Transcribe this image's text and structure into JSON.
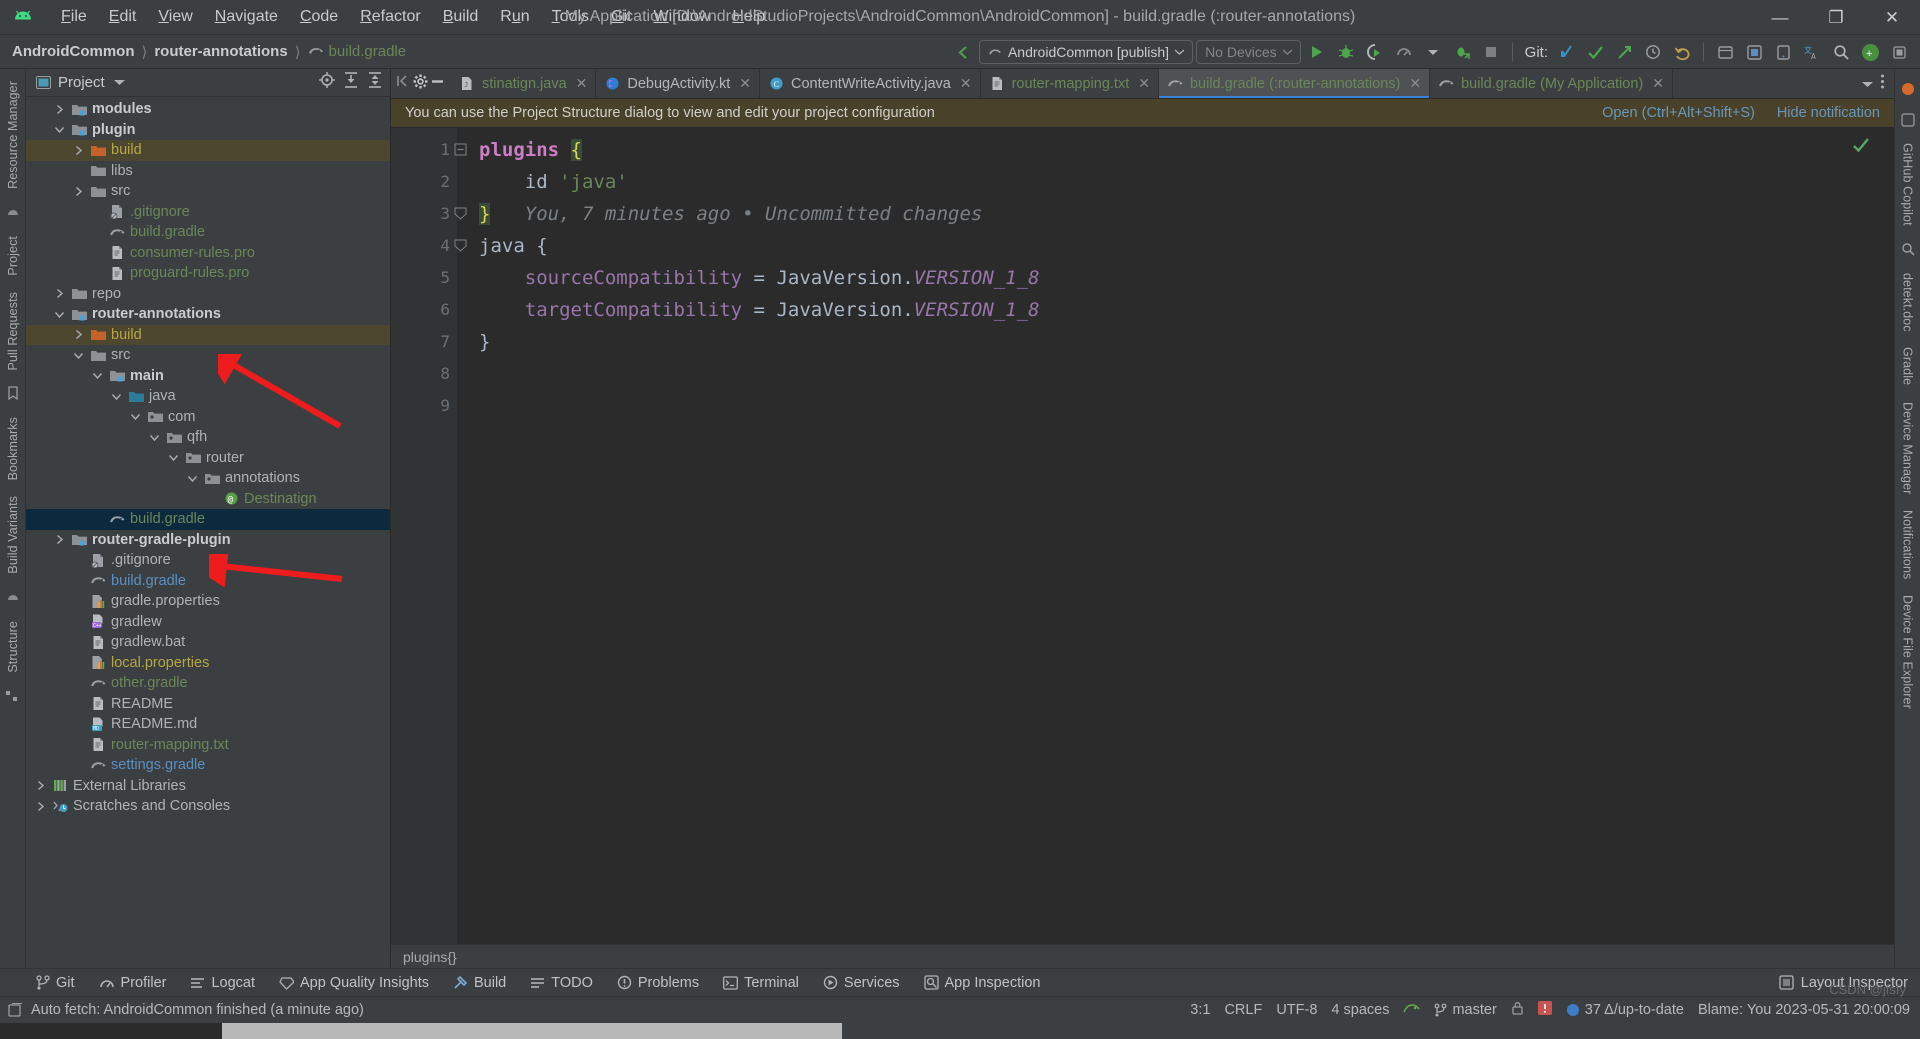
{
  "window": {
    "title": "My Application [D:\\AndroidStudioProjects\\AndroidCommon\\AndroidCommon] - build.gradle (:router-annotations)",
    "minimize": "—",
    "maximize": "❐",
    "close": "✕"
  },
  "menubar": {
    "logo_name": "android-logo",
    "items": [
      {
        "label": "File"
      },
      {
        "label": "Edit"
      },
      {
        "label": "View"
      },
      {
        "label": "Navigate"
      },
      {
        "label": "Code"
      },
      {
        "label": "Refactor"
      },
      {
        "label": "Build"
      },
      {
        "label": "Run"
      },
      {
        "label": "Tools"
      },
      {
        "label": "Git"
      },
      {
        "label": "Window"
      },
      {
        "label": "Help"
      }
    ]
  },
  "navbar": {
    "breadcrumbs": [
      {
        "label": "AndroidCommon",
        "style": "bold"
      },
      {
        "label": "router-annotations",
        "style": "bold"
      },
      {
        "label": "build.gradle",
        "style": "green"
      }
    ],
    "separator": "〉",
    "run_config": "AndroidCommon [publish]",
    "device": "No Devices",
    "git_label": "Git:",
    "icons": [
      "back-arrow-icon",
      "run-icon",
      "debug-icon",
      "run-coverage-icon",
      "profiler-icon",
      "dropdown-icon",
      "attach-debugger-icon",
      "stop-icon",
      "git-update-icon",
      "git-commit-icon",
      "git-push-icon",
      "history-icon",
      "undo-icon",
      "search-everywhere-icon",
      "layout-inspector-icon",
      "device-manager-icon",
      "translate-icon",
      "search-icon",
      "avatar-icon",
      "more-icon"
    ]
  },
  "left_strip": {
    "tabs": [
      {
        "label": "Resource Manager"
      },
      {
        "label": "Project"
      },
      {
        "label": "Pull Requests"
      },
      {
        "label": "Bookmarks"
      },
      {
        "label": "Build Variants"
      },
      {
        "label": "Structure"
      }
    ]
  },
  "right_strip": {
    "tabs": [
      {
        "label": "GitHub Copilot"
      },
      {
        "label": "detekt.doc"
      },
      {
        "label": "Gradle"
      },
      {
        "label": "Device Manager"
      },
      {
        "label": "Notifications"
      },
      {
        "label": "Device File Explorer"
      }
    ]
  },
  "project_panel": {
    "title": "Project",
    "dropdown_icon": "chevron-down-icon",
    "head_icons": [
      "locate-icon",
      "expand-all-icon",
      "collapse-all-icon"
    ],
    "tree": [
      {
        "label": "modules",
        "indent": 1,
        "chev": "right",
        "icon": "module-folder-icon",
        "color": "grey",
        "bold": true,
        "state": ""
      },
      {
        "label": "plugin",
        "indent": 1,
        "chev": "down",
        "icon": "module-folder-icon",
        "color": "grey",
        "bold": true,
        "state": ""
      },
      {
        "label": "build",
        "indent": 2,
        "chev": "right",
        "icon": "excluded-folder-icon",
        "color": "olive",
        "bold": false,
        "state": "module-selected"
      },
      {
        "label": "libs",
        "indent": 2,
        "chev": "none",
        "icon": "folder-icon",
        "color": "grey",
        "bold": false,
        "state": ""
      },
      {
        "label": "src",
        "indent": 2,
        "chev": "right",
        "icon": "folder-icon",
        "color": "grey",
        "bold": false,
        "state": ""
      },
      {
        "label": ".gitignore",
        "indent": 3,
        "chev": "none",
        "icon": "gitignore-file-icon",
        "color": "green",
        "bold": false,
        "state": ""
      },
      {
        "label": "build.gradle",
        "indent": 3,
        "chev": "none",
        "icon": "gradle-file-icon",
        "color": "green",
        "bold": false,
        "state": ""
      },
      {
        "label": "consumer-rules.pro",
        "indent": 3,
        "chev": "none",
        "icon": "text-file-icon",
        "color": "green",
        "bold": false,
        "state": ""
      },
      {
        "label": "proguard-rules.pro",
        "indent": 3,
        "chev": "none",
        "icon": "text-file-icon",
        "color": "green",
        "bold": false,
        "state": ""
      },
      {
        "label": "repo",
        "indent": 1,
        "chev": "right",
        "icon": "folder-icon",
        "color": "grey",
        "bold": false,
        "state": ""
      },
      {
        "label": "router-annotations",
        "indent": 1,
        "chev": "down",
        "icon": "module-folder-icon",
        "color": "grey",
        "bold": true,
        "state": ""
      },
      {
        "label": "build",
        "indent": 2,
        "chev": "right",
        "icon": "excluded-folder-icon",
        "color": "olive",
        "bold": false,
        "state": "module-selected"
      },
      {
        "label": "src",
        "indent": 2,
        "chev": "down",
        "icon": "folder-icon",
        "color": "grey",
        "bold": false,
        "state": ""
      },
      {
        "label": "main",
        "indent": 3,
        "chev": "down",
        "icon": "module-folder-icon",
        "color": "grey",
        "bold": true,
        "state": ""
      },
      {
        "label": "java",
        "indent": 4,
        "chev": "down",
        "icon": "source-folder-icon",
        "color": "grey",
        "bold": false,
        "state": ""
      },
      {
        "label": "com",
        "indent": 5,
        "chev": "down",
        "icon": "package-icon",
        "color": "grey",
        "bold": false,
        "state": ""
      },
      {
        "label": "qfh",
        "indent": 6,
        "chev": "down",
        "icon": "package-icon",
        "color": "grey",
        "bold": false,
        "state": ""
      },
      {
        "label": "router",
        "indent": 7,
        "chev": "down",
        "icon": "package-icon",
        "color": "grey",
        "bold": false,
        "state": ""
      },
      {
        "label": "annotations",
        "indent": 8,
        "chev": "down",
        "icon": "package-icon",
        "color": "grey",
        "bold": false,
        "state": ""
      },
      {
        "label": "Destinatign",
        "indent": 9,
        "chev": "none",
        "icon": "annotation-icon",
        "color": "green",
        "bold": false,
        "state": ""
      },
      {
        "label": "build.gradle",
        "indent": 3,
        "chev": "none",
        "icon": "gradle-file-icon",
        "color": "green",
        "bold": false,
        "state": "file-selected"
      },
      {
        "label": "router-gradle-plugin",
        "indent": 1,
        "chev": "right",
        "icon": "module-folder-icon",
        "color": "grey",
        "bold": true,
        "state": ""
      },
      {
        "label": ".gitignore",
        "indent": 2,
        "chev": "none",
        "icon": "gitignore-file-icon",
        "color": "grey",
        "bold": false,
        "state": ""
      },
      {
        "label": "build.gradle",
        "indent": 2,
        "chev": "none",
        "icon": "gradle-file-icon",
        "color": "blue",
        "bold": false,
        "state": ""
      },
      {
        "label": "gradle.properties",
        "indent": 2,
        "chev": "none",
        "icon": "properties-file-icon",
        "color": "grey",
        "bold": false,
        "state": ""
      },
      {
        "label": "gradlew",
        "indent": 2,
        "chev": "none",
        "icon": "cpp-file-icon",
        "color": "grey",
        "bold": false,
        "state": ""
      },
      {
        "label": "gradlew.bat",
        "indent": 2,
        "chev": "none",
        "icon": "text-file-icon",
        "color": "grey",
        "bold": false,
        "state": ""
      },
      {
        "label": "local.properties",
        "indent": 2,
        "chev": "none",
        "icon": "properties-file-icon",
        "color": "olive",
        "bold": false,
        "state": ""
      },
      {
        "label": "other.gradle",
        "indent": 2,
        "chev": "none",
        "icon": "gradle-file-icon",
        "color": "green",
        "bold": false,
        "state": ""
      },
      {
        "label": "README",
        "indent": 2,
        "chev": "none",
        "icon": "text-file-icon",
        "color": "grey",
        "bold": false,
        "state": ""
      },
      {
        "label": "README.md",
        "indent": 2,
        "chev": "none",
        "icon": "markdown-file-icon",
        "color": "grey",
        "bold": false,
        "state": ""
      },
      {
        "label": "router-mapping.txt",
        "indent": 2,
        "chev": "none",
        "icon": "text-file-icon",
        "color": "green",
        "bold": false,
        "state": ""
      },
      {
        "label": "settings.gradle",
        "indent": 2,
        "chev": "none",
        "icon": "gradle-file-icon",
        "color": "blue",
        "bold": false,
        "state": ""
      },
      {
        "label": "External Libraries",
        "indent": 0,
        "chev": "right",
        "icon": "libraries-icon",
        "color": "grey",
        "bold": false,
        "state": ""
      },
      {
        "label": "Scratches and Consoles",
        "indent": 0,
        "chev": "right",
        "icon": "scratches-icon",
        "color": "grey",
        "bold": false,
        "state": ""
      }
    ]
  },
  "editor": {
    "lead_icons": [
      "collapse-icon",
      "settings-gear-icon",
      "minimize-icon"
    ],
    "tabs": [
      {
        "label": "stinatign.java",
        "icon": "java-file-icon",
        "color": "green",
        "active": false
      },
      {
        "label": "DebugActivity.kt",
        "icon": "kotlin-file-icon",
        "color": "plain",
        "active": false
      },
      {
        "label": "ContentWriteActivity.java",
        "icon": "class-file-icon",
        "color": "plain",
        "active": false
      },
      {
        "label": "router-mapping.txt",
        "icon": "text-file-icon",
        "color": "green",
        "active": false
      },
      {
        "label": "build.gradle (:router-annotations)",
        "icon": "gradle-file-icon",
        "color": "green",
        "active": true
      },
      {
        "label": "build.gradle (My Application)",
        "icon": "gradle-file-icon",
        "color": "green",
        "active": false
      }
    ],
    "trail_icons": [
      "chevron-down-icon",
      "more-vertical-icon"
    ],
    "notification": {
      "message": "You can use the Project Structure dialog to view and edit your project configuration",
      "open_action": "Open (Ctrl+Alt+Shift+S)",
      "hide_action": "Hide notification"
    },
    "line_numbers": [
      "1",
      "2",
      "3",
      "4",
      "5",
      "6",
      "7",
      "8",
      "9"
    ],
    "code_lines": [
      {
        "n": 1,
        "tokens": [
          {
            "t": "plugins",
            "c": "plugin"
          },
          {
            "t": " ",
            "c": "plain"
          },
          {
            "t": "{",
            "c": "brace-hl"
          }
        ]
      },
      {
        "n": 2,
        "tokens": [
          {
            "t": "    ",
            "c": "plain"
          },
          {
            "t": "id",
            "c": "id"
          },
          {
            "t": " ",
            "c": "plain"
          },
          {
            "t": "'java'",
            "c": "str"
          }
        ]
      },
      {
        "n": 3,
        "tokens": [
          {
            "t": "}",
            "c": "brace-hl"
          },
          {
            "t": "   ",
            "c": "plain"
          },
          {
            "t": "You, 7 minutes ago • Uncommitted changes",
            "c": "hint"
          }
        ]
      },
      {
        "n": 4,
        "tokens": [
          {
            "t": "java",
            "c": "plain"
          },
          {
            "t": " ",
            "c": "plain"
          },
          {
            "t": "{",
            "c": "plain"
          }
        ]
      },
      {
        "n": 5,
        "tokens": [
          {
            "t": "    ",
            "c": "plain"
          },
          {
            "t": "sourceCompatibility",
            "c": "prop"
          },
          {
            "t": " = ",
            "c": "plain"
          },
          {
            "t": "JavaVersion.",
            "c": "plain"
          },
          {
            "t": "VERSION_1_8",
            "c": "field"
          }
        ]
      },
      {
        "n": 6,
        "tokens": [
          {
            "t": "    ",
            "c": "plain"
          },
          {
            "t": "targetCompatibility",
            "c": "prop"
          },
          {
            "t": " = ",
            "c": "plain"
          },
          {
            "t": "JavaVersion.",
            "c": "plain"
          },
          {
            "t": "VERSION_1_8",
            "c": "field"
          }
        ]
      },
      {
        "n": 7,
        "tokens": [
          {
            "t": "}",
            "c": "plain"
          }
        ]
      },
      {
        "n": 8,
        "tokens": []
      },
      {
        "n": 9,
        "tokens": []
      }
    ],
    "breadcrumb": "plugins{}"
  },
  "toolwindows": {
    "items": [
      {
        "label": "Git",
        "icon": "git-branch-icon"
      },
      {
        "label": "Profiler",
        "icon": "profiler-icon"
      },
      {
        "label": "Logcat",
        "icon": "logcat-icon"
      },
      {
        "label": "App Quality Insights",
        "icon": "gem-icon"
      },
      {
        "label": "Build",
        "icon": "hammer-icon"
      },
      {
        "label": "TODO",
        "icon": "todo-icon"
      },
      {
        "label": "Problems",
        "icon": "problems-icon"
      },
      {
        "label": "Terminal",
        "icon": "terminal-icon"
      },
      {
        "label": "Services",
        "icon": "services-icon"
      },
      {
        "label": "App Inspection",
        "icon": "app-inspection-icon"
      }
    ],
    "right": {
      "label": "Layout Inspector",
      "icon": "layout-inspector-icon"
    }
  },
  "statusbar": {
    "message": "Auto fetch: AndroidCommon finished (a minute ago)",
    "caret": "3:1",
    "line_sep": "CRLF",
    "encoding": "UTF-8",
    "indent": "4 spaces",
    "branch": "master",
    "gradle_sync": "37 Δ/up-to-date",
    "blame": "Blame: You 2023-05-31 20:00:09",
    "icons": [
      "event-log-icon",
      "lock-icon",
      "inspection-icon",
      "gradle-status-icon"
    ]
  },
  "watermark": "CSDN @jfsfy",
  "colors": {
    "accent_blue": "#3d82d6",
    "selection_blue": "#0d293e",
    "selection_brown": "#4e4730",
    "notification_bg": "#4a412a",
    "green_text": "#6a8759",
    "panel_bg": "#3c3f41",
    "editor_bg": "#2b2b2b",
    "arrow_red": "#ee1c1c"
  }
}
